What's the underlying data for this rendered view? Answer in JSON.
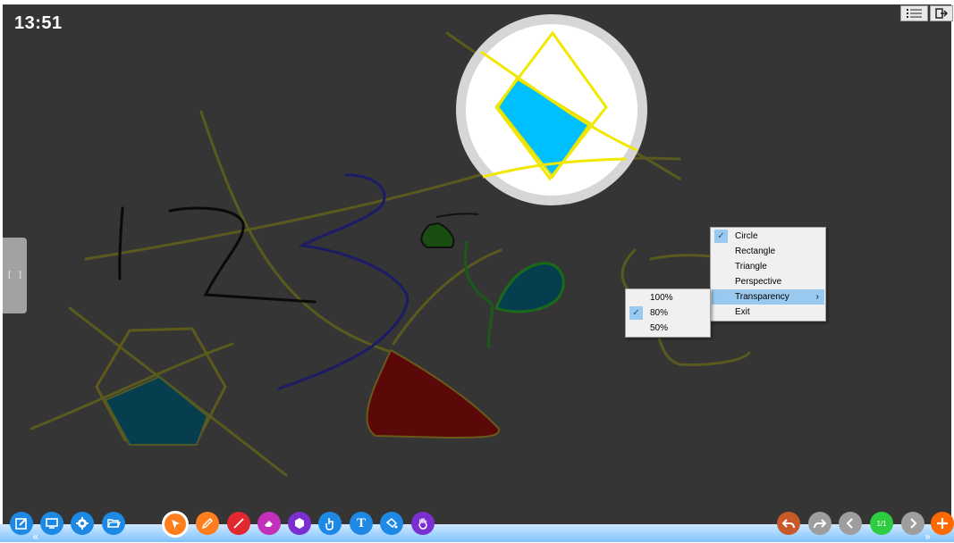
{
  "header": {
    "clock": "13:51",
    "menu_icon": "list-icon",
    "exit_icon": "exit-icon"
  },
  "side_handle": {
    "label": "[ ]"
  },
  "context_menu": {
    "items": [
      {
        "label": "Circle",
        "checked": true
      },
      {
        "label": "Rectangle",
        "checked": false
      },
      {
        "label": "Triangle",
        "checked": false
      },
      {
        "label": "Perspective",
        "checked": false
      },
      {
        "label": "Transparency",
        "highlighted": true,
        "submenu": true
      },
      {
        "label": "Exit",
        "checked": false
      }
    ],
    "check_glyph": "✓",
    "submenu_arrow": "›"
  },
  "transparency_menu": {
    "items": [
      {
        "label": "100%",
        "checked": false
      },
      {
        "label": "80%",
        "checked": true
      },
      {
        "label": "50%",
        "checked": false
      }
    ]
  },
  "toolbar": {
    "left_tools": [
      "edit-icon",
      "screen-icon",
      "gear-icon",
      "folder-icon"
    ],
    "draw_tools": [
      "select-pointer-icon",
      "pen-icon",
      "line-icon",
      "eraser-icon",
      "shape-icon",
      "touch-icon",
      "text-icon",
      "fill-bucket-icon",
      "hand-icon"
    ],
    "text_tool_label": "T",
    "page_indicator": "1/1",
    "colors": {
      "blue": "#1e88e5",
      "orange": "#ff7f1f",
      "red": "#e0282e",
      "magenta": "#c22fb8",
      "purple": "#7b2fd0",
      "undo": "#c85a2a",
      "grey": "#9e9e9e",
      "green": "#2ecc40",
      "add": "#ff6a00"
    },
    "collapse_left": "«",
    "collapse_right": "»"
  },
  "canvas": {
    "background": "#353535",
    "spotlight_color": "#ffffff",
    "spotlight_ring": "#d6d6d6"
  }
}
